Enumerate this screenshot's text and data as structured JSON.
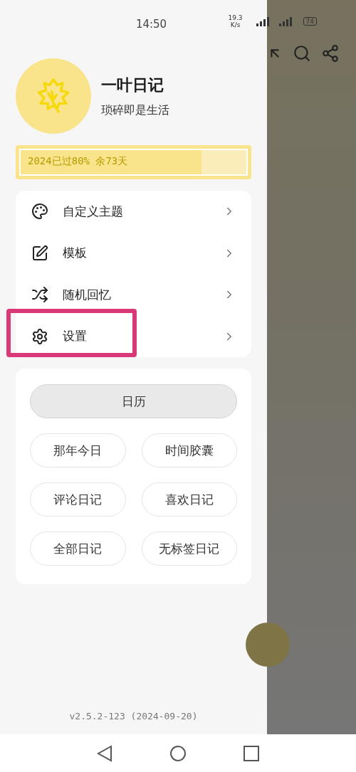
{
  "status_bar": {
    "time": "14:50",
    "speed": "19.3 K/s",
    "battery": "74"
  },
  "profile": {
    "name": "一叶日记",
    "motto": "琐碎即是生活"
  },
  "year_progress": {
    "label": "2024已过80% 余73天",
    "level": 0.8
  },
  "menu": [
    {
      "label": "自定义主题",
      "kind": "palette",
      "highlighted": false
    },
    {
      "label": "模板",
      "kind": "edit",
      "highlighted": false
    },
    {
      "label": "随机回忆",
      "kind": "shuffle",
      "highlighted": false
    },
    {
      "label": "设置",
      "kind": "settings",
      "highlighted": true
    }
  ],
  "shortcuts": [
    {
      "label": "日历",
      "kind": "wide"
    },
    {
      "label": "那年今日",
      "kind": "pill"
    },
    {
      "label": "时间胶囊",
      "kind": "pill"
    },
    {
      "label": "评论日记",
      "kind": "pill"
    },
    {
      "label": "喜欢日记",
      "kind": "pill"
    },
    {
      "label": "全部日记",
      "kind": "pill"
    },
    {
      "label": "无标签日记",
      "kind": "pill"
    }
  ],
  "version": "v2.5.2-123 (2024-09-20)"
}
